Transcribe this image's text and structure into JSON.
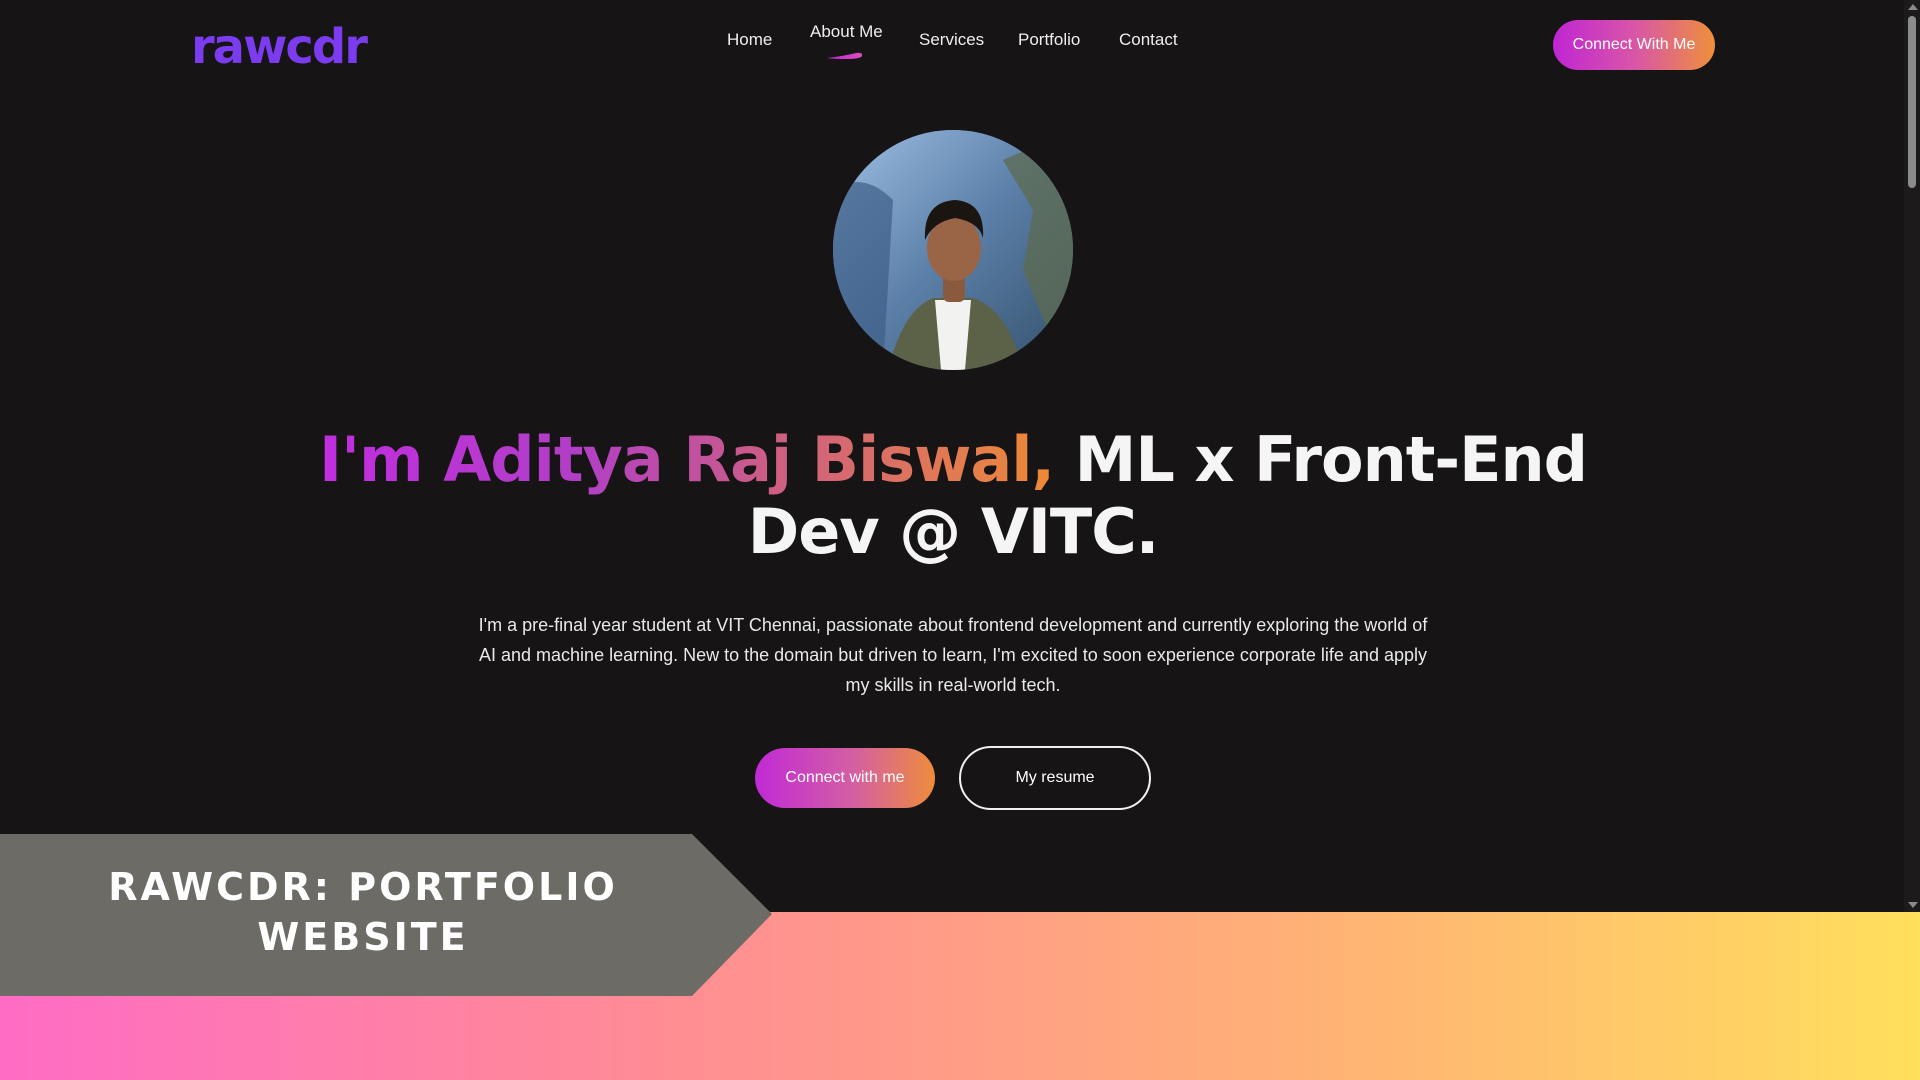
{
  "brand": {
    "logo_text": "rawcdr"
  },
  "nav": {
    "items": [
      {
        "label": "Home"
      },
      {
        "label": "About Me",
        "active": true
      },
      {
        "label": "Services"
      },
      {
        "label": "Portfolio"
      },
      {
        "label": "Contact"
      }
    ]
  },
  "header": {
    "cta_label": "Connect With Me"
  },
  "hero": {
    "avatar_icon": "profile-photo",
    "headline_gradient": "I'm Aditya Raj Biswal,",
    "headline_plain": "ML x Front-End Dev @ VITC.",
    "bio": "I'm a pre-final year student at VIT Chennai, passionate about frontend development and currently exploring the world of AI and machine learning. New to the domain but driven to learn, I'm excited to soon experience corporate life and apply my skills in real-world tech.",
    "primary_button": "Connect with me",
    "secondary_button": "My resume"
  },
  "banner": {
    "title_line1": "RAWCDR: PORTFOLIO",
    "title_line2": "WEBSITE"
  },
  "colors": {
    "background": "#161414",
    "logo": "#7b3cf0",
    "gradient_start": "#c026d3",
    "gradient_end": "#ef8f3a",
    "banner_label": "#6c6b66",
    "banner_gradient_left": "#ff6cc4",
    "banner_gradient_right": "#ffdf5c"
  }
}
